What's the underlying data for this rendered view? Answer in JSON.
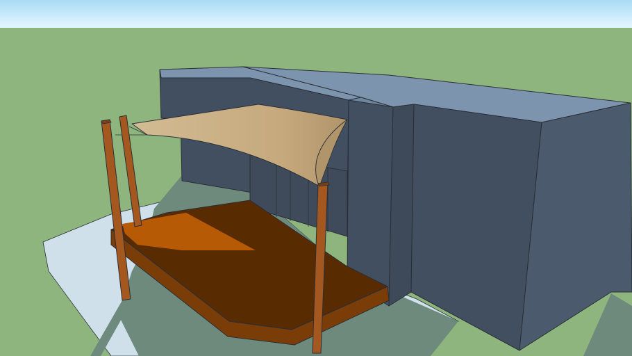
{
  "scene": {
    "colors": {
      "sky_top": "#a9dbf5",
      "sky_bottom": "#e6f6ff",
      "ground": "#8eb57d",
      "shadow": "#6e8a7d",
      "pavement": "#cfe0ea",
      "building_front": "#424f60",
      "building_top": "#7d94ae",
      "building_side": "#4b5a6c",
      "sail": "#c8ad82",
      "sail_shade": "#b0946a",
      "deck_top": "#582b00",
      "deck_sunlit": "#b75a06",
      "deck_edge": "#7b3d07",
      "post": "#a4571f",
      "post_dark": "#7d3f14"
    },
    "objects": [
      "sky",
      "ground-plane",
      "building",
      "shade-sail",
      "timber-deck",
      "timber-posts"
    ]
  }
}
